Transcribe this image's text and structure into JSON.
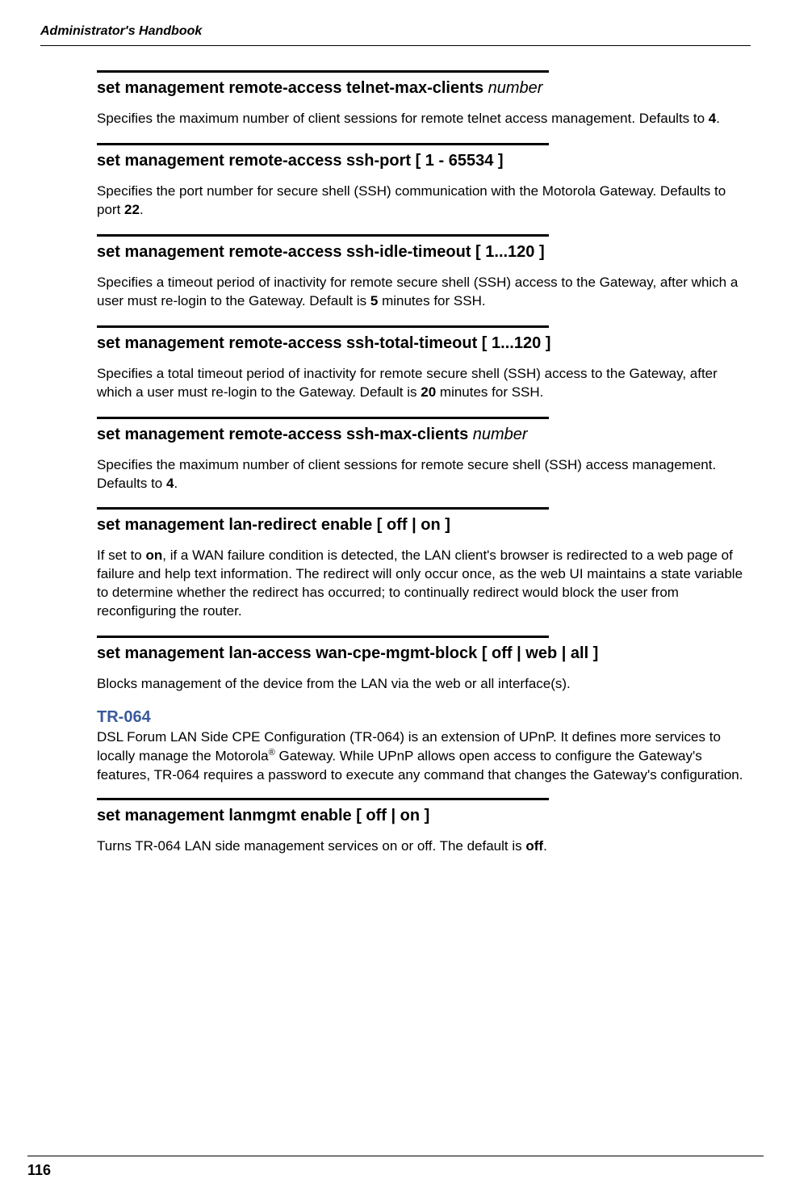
{
  "header": {
    "title": "Administrator's Handbook"
  },
  "commands": [
    {
      "title_bold": "set management remote-access telnet-max-clients ",
      "title_param": "number",
      "desc_html": "Specifies the maximum number of client sessions for remote telnet access management. Defaults to <b>4</b>."
    },
    {
      "title_bold": "set management remote-access ssh-port [ 1 - 65534 ]",
      "title_param": "",
      "desc_html": "Specifies the port number for secure shell (SSH) communication with the Motorola Gateway. Defaults to port <b>22</b>."
    },
    {
      "title_bold": "set management remote-access ssh-idle-timeout [ 1...120 ]",
      "title_param": "",
      "desc_html": "Specifies a timeout period of inactivity for remote secure shell (SSH) access to the Gateway, after which a user must re-login to the Gateway. Default is <b>5</b> minutes for SSH."
    },
    {
      "title_bold": "set management remote-access ssh-total-timeout [ 1...120 ]",
      "title_param": "",
      "desc_html": "Specifies a total timeout period of inactivity for remote secure shell (SSH) access to the Gateway, after which a user must re-login to the Gateway. Default is <b>20</b> minutes for SSH."
    },
    {
      "title_bold": "set management remote-access ssh-max-clients ",
      "title_param": "number",
      "desc_html": "Specifies the maximum number of client sessions for remote secure shell (SSH) access management. Defaults to <b>4</b>."
    },
    {
      "title_bold": "set management lan-redirect enable [ off | on ]",
      "title_param": "",
      "desc_html": "If set to <b>on</b>, if a WAN failure condition is detected, the LAN client's browser is redirected to a web page of failure and help text information. The redirect will only occur once, as the web UI maintains a state variable to determine whether the redirect has occurred; to continually redirect would block the user from reconfiguring the router."
    },
    {
      "title_bold": "set management lan-access wan-cpe-mgmt-block [ off | web | all ]",
      "title_param": "",
      "desc_html": "Blocks management of the device from the LAN via the web or all interface(s)."
    }
  ],
  "section": {
    "heading": "TR-064",
    "desc_html": "DSL Forum LAN Side CPE Configuration (TR-064) is an extension of UPnP. It defines more services to locally manage the Motorola<sup>®</sup> Gateway. While UPnP allows open access to configure the Gateway's features, TR-064 requires a password to execute any command that changes the Gateway's configuration."
  },
  "commands2": [
    {
      "title_bold": "set management lanmgmt enable [ off | on ]",
      "title_param": "",
      "desc_html": "Turns TR-064 LAN side management services on or off. The default is <b>off</b>."
    }
  ],
  "footer": {
    "page": "116"
  }
}
